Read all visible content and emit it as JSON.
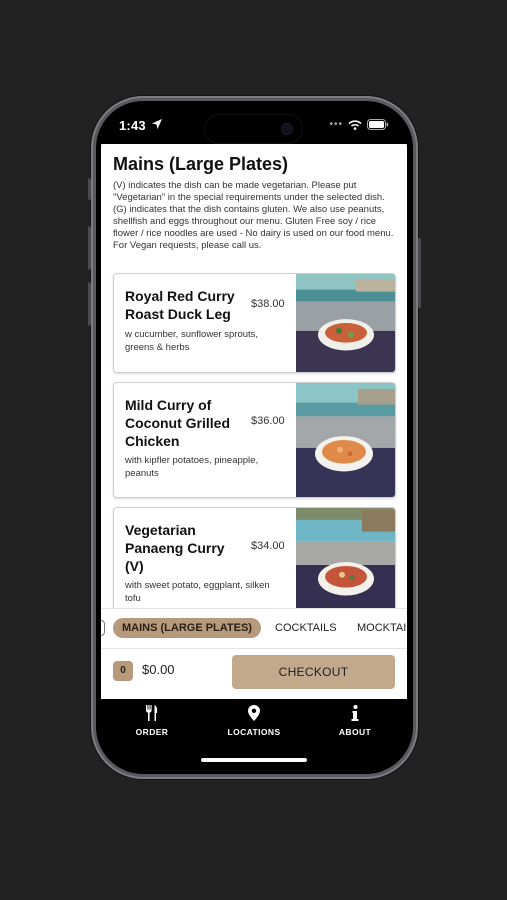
{
  "status_bar": {
    "time": "1:43"
  },
  "section": {
    "title": "Mains (Large Plates)",
    "intro": "(V) indicates the dish can be made vegetarian. Please put \"Vegetarian\" in the special requirements under the selected dish. (G) indicates that the dish contains gluten. We also use peanuts, shellfish and eggs throughout our menu. Gluten Free soy / rice flower / rice noodles are used - No dairy is used on our food menu. For Vegan requests, please call us."
  },
  "menu_items": [
    {
      "name": "Royal Red Curry Roast Duck Leg",
      "price": "$38.00",
      "description": "w cucumber, sunflower sprouts, greens & herbs"
    },
    {
      "name": "Mild Curry of Coconut Grilled Chicken",
      "price": "$36.00",
      "description": "with kipfler potatoes, pineapple, peanuts"
    },
    {
      "name": "Vegetarian Panaeng Curry (V)",
      "price": "$34.00",
      "description": "with sweet potato, eggplant, silken tofu"
    }
  ],
  "categories": {
    "active": "MAINS (LARGE PLATES)",
    "items": [
      "COCKTAILS",
      "MOCKTAILS"
    ]
  },
  "cart": {
    "count": "0",
    "total": "$0.00",
    "checkout_label": "CHECKOUT"
  },
  "nav": {
    "order": "ORDER",
    "locations": "LOCATIONS",
    "about": "ABOUT"
  },
  "colors": {
    "accent": "#b79a7b",
    "checkout": "#c3a98c",
    "nav_bg": "#000000"
  },
  "icons": {
    "order": "fork-knife-icon",
    "locations": "map-pin-icon",
    "about": "info-icon"
  }
}
